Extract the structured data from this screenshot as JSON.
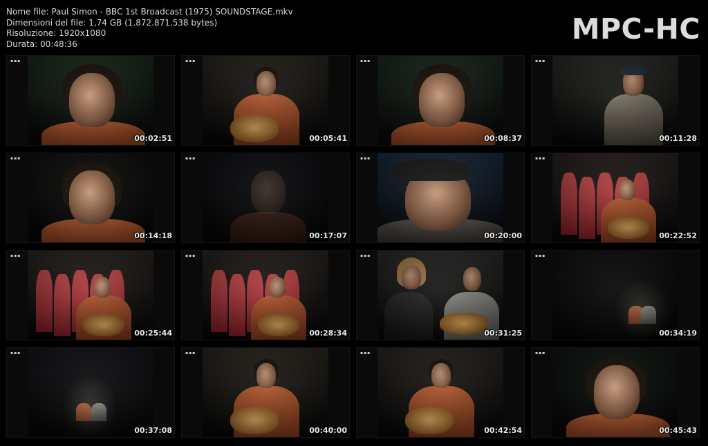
{
  "file_info": {
    "name": "Nome file: Paul Simon - BBC 1st Broadcast (1975) SOUNDSTAGE.mkv",
    "size": "Dimensioni del file: 1,74 GB (1.872.871.538 bytes)",
    "resolution": "Risoluzione: 1920x1080",
    "duration": "Durata: 00:48:36"
  },
  "logo": "MPC-HC",
  "thumbnail_marker": "▪▪▪",
  "thumbnails": [
    {
      "time": "00:02:51",
      "scene": "closeup",
      "bg": "#1c2b1e"
    },
    {
      "time": "00:05:41",
      "scene": "guitar",
      "bg": "#2a2620"
    },
    {
      "time": "00:08:37",
      "scene": "closeup",
      "bg": "#1d2a1f"
    },
    {
      "time": "00:11:28",
      "scene": "harmonica",
      "bg": "#2a2a26"
    },
    {
      "time": "00:14:18",
      "scene": "closeup",
      "bg": "#10120f"
    },
    {
      "time": "00:17:07",
      "scene": "dark",
      "bg": "#0f1014"
    },
    {
      "time": "00:20:00",
      "scene": "cap",
      "bg": "#1a2b3d"
    },
    {
      "time": "00:22:52",
      "scene": "choir",
      "bg": "#2a2320"
    },
    {
      "time": "00:25:44",
      "scene": "choir",
      "bg": "#2b2521"
    },
    {
      "time": "00:28:34",
      "scene": "choir",
      "bg": "#2a2420"
    },
    {
      "time": "00:31:25",
      "scene": "duo",
      "bg": "#2c2b2a"
    },
    {
      "time": "00:34:19",
      "scene": "wide",
      "bg": "#111"
    },
    {
      "time": "00:37:08",
      "scene": "widelit",
      "bg": "#15161a"
    },
    {
      "time": "00:40:00",
      "scene": "guitar",
      "bg": "#2c2720"
    },
    {
      "time": "00:42:54",
      "scene": "guitar",
      "bg": "#2a2520"
    },
    {
      "time": "00:45:43",
      "scene": "closeup",
      "bg": "#101712"
    }
  ]
}
